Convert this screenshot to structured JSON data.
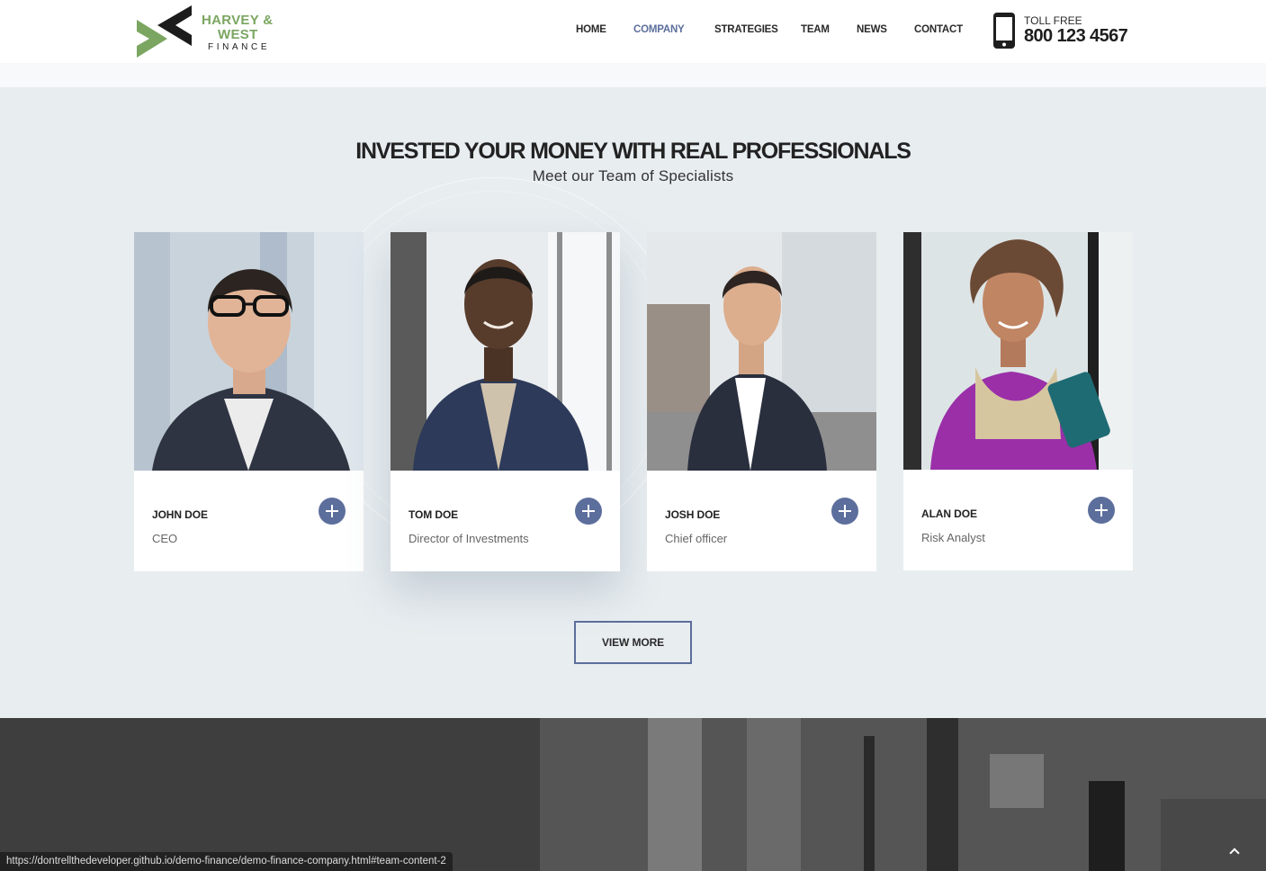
{
  "brand": {
    "line1": "HARVEY &",
    "line2": "WEST",
    "line3": "FINANCE",
    "green": "#7ba661",
    "dark": "#1c1c1c"
  },
  "nav": {
    "items": [
      {
        "label": "HOME",
        "active": false
      },
      {
        "label": "COMPANY",
        "active": true
      },
      {
        "label": "STRATEGIES",
        "active": false
      },
      {
        "label": "TEAM",
        "active": false
      },
      {
        "label": "NEWS",
        "active": false
      },
      {
        "label": "CONTACT",
        "active": false
      }
    ],
    "active_color": "#5c6e9c"
  },
  "contact": {
    "icon": "smartphone-icon",
    "label": "TOLL FREE",
    "number": "800 123 4567"
  },
  "team": {
    "title": "INVESTED YOUR MONEY WITH REAL PROFESSIONALS",
    "subtitle": "Meet our Team of Specialists",
    "members": [
      {
        "name": "JOHN DOE",
        "role": "CEO"
      },
      {
        "name": "TOM DOE",
        "role": "Director of Investments"
      },
      {
        "name": "JOSH DOE",
        "role": "Chief officer"
      },
      {
        "name": "ALAN DOE",
        "role": "Risk Analyst"
      }
    ],
    "plus_icon": "plus-icon",
    "view_more": "VIEW MORE",
    "accent": "#5c6e9c"
  },
  "status_bar": {
    "url": "https://dontrellthedeveloper.github.io/demo-finance/demo-finance-company.html#team-content-2"
  },
  "scroll_top": {
    "icon": "chevron-up-icon"
  }
}
